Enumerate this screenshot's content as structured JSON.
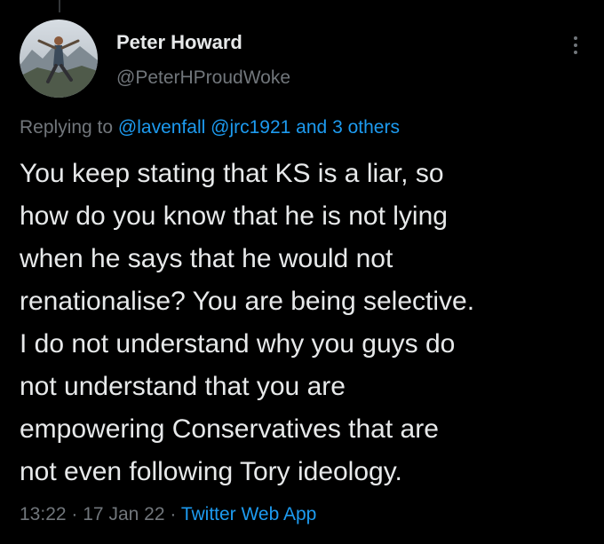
{
  "tweet": {
    "author_name": "Peter Howard",
    "author_handle": "@PeterHProudWoke",
    "replying_prefix": "Replying to",
    "reply_mentions": [
      "@lavenfall",
      "@jrc1921"
    ],
    "reply_and": "and",
    "reply_others": "3 others",
    "text_lines": [
      "You keep stating that KS is a liar, so",
      "how do you know that he is not lying",
      "when he says that he would not",
      "renationalise? You are being selective.",
      "I do not understand why you guys do",
      "not understand that you are",
      "empowering Conservatives that are",
      "not even following Tory ideology."
    ],
    "time": "13:22",
    "separator": "·",
    "date": "17 Jan 22",
    "source": "Twitter Web App"
  },
  "icons": {
    "more": "more-vertical-icon",
    "avatar": "profile-photo"
  },
  "colors": {
    "background": "#000000",
    "text": "#e7e9ea",
    "muted": "#71767b",
    "link": "#1d9bf0"
  }
}
